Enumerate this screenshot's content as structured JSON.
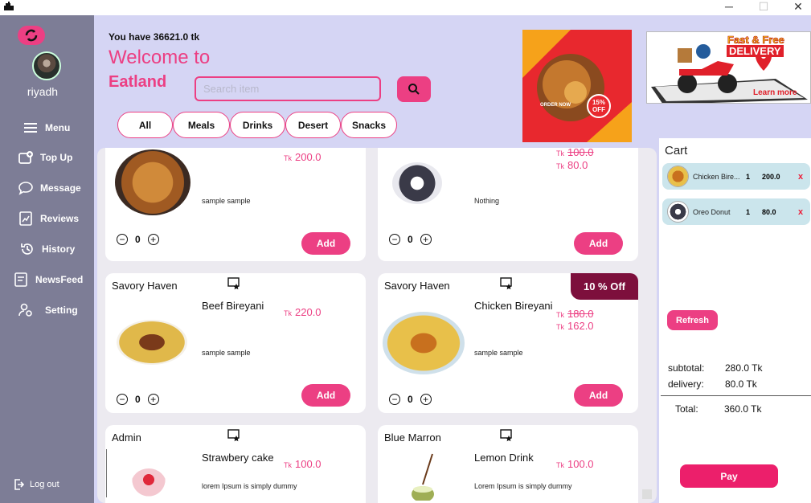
{
  "window": {
    "minimize": "─",
    "maximize": "☐",
    "close": "✕"
  },
  "sidebar": {
    "username": "riyadh",
    "items": [
      {
        "label": "Menu",
        "icon": "hamburger-icon"
      },
      {
        "label": "Top Up",
        "icon": "wallet-icon"
      },
      {
        "label": "Message",
        "icon": "chat-bubble-icon"
      },
      {
        "label": "Reviews",
        "icon": "review-icon"
      },
      {
        "label": "History",
        "icon": "history-icon"
      },
      {
        "label": "NewsFeed",
        "icon": "newsfeed-icon"
      },
      {
        "label": "Setting",
        "icon": "settings-icon"
      }
    ],
    "logout": "Log out"
  },
  "header": {
    "balance": "You have  36621.0 tk",
    "welcome": "Welcome to",
    "brand": "Eatland",
    "search_placeholder": "Search item"
  },
  "categories": [
    "All",
    "Meals",
    "Drinks",
    "Desert",
    "Snacks"
  ],
  "banners": {
    "promo_text": "ORDER NOW",
    "promo_badge": "15% OFF",
    "delivery_title": "Fast & Free",
    "delivery_sub": "DELIVERY",
    "delivery_link": "Learn more"
  },
  "products": [
    {
      "restaurant": "",
      "name": "",
      "price": "200.0",
      "old_price": "",
      "desc": "sample sample",
      "qty": "0",
      "add": "Add"
    },
    {
      "restaurant": "",
      "name": "",
      "price": "80.0",
      "old_price": "100.0",
      "desc": "Nothing",
      "qty": "0",
      "add": "Add"
    },
    {
      "restaurant": "Savory Haven",
      "name": "Beef Bireyani",
      "price": "220.0",
      "old_price": "",
      "desc": "sample sample",
      "qty": "0",
      "add": "Add"
    },
    {
      "restaurant": "Savory Haven",
      "name": "Chicken Bireyani",
      "price": "162.0",
      "old_price": "180.0",
      "desc": "sample sample",
      "qty": "0",
      "add": "Add",
      "discount": "10 % Off"
    },
    {
      "restaurant": "Admin",
      "name": "Strawbery cake",
      "price": "100.0",
      "old_price": "",
      "desc": "lorem Ipsum is simply dummy"
    },
    {
      "restaurant": "Blue Marron",
      "name": "Lemon Drink",
      "price": "100.0",
      "old_price": "",
      "desc": "Lorem Ipsum is simply dummy"
    }
  ],
  "currency": "Tk",
  "cart": {
    "title": "Cart",
    "items": [
      {
        "name": "Chicken Bire...",
        "qty": "1",
        "price": "200.0",
        "remove": "x"
      },
      {
        "name": "Oreo Donut",
        "qty": "1",
        "price": "80.0",
        "remove": "x"
      }
    ],
    "refresh": "Refresh",
    "subtotal_label": "subtotal:",
    "subtotal": "280.0 Tk",
    "delivery_label": "delivery:",
    "delivery": "80.0 Tk",
    "total_label": "Total:",
    "total": "360.0 Tk",
    "pay": "Pay"
  }
}
